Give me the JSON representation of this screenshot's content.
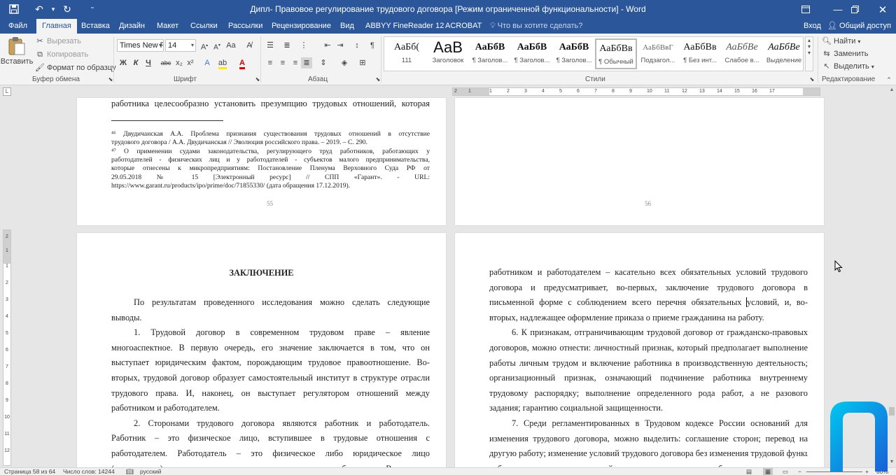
{
  "titlebar": {
    "title": "Дипл- Правовое регулирование трудового договора [Режим ограниченной функциональности] - Word",
    "save_icon": "save-icon",
    "undo_icon": "undo-icon",
    "redo_icon": "redo-icon"
  },
  "tabs": [
    {
      "label": "Файл"
    },
    {
      "label": "Главная",
      "active": true
    },
    {
      "label": "Вставка"
    },
    {
      "label": "Дизайн"
    },
    {
      "label": "Макет"
    },
    {
      "label": "Ссылки"
    },
    {
      "label": "Рассылки"
    },
    {
      "label": "Рецензирование"
    },
    {
      "label": "Вид"
    },
    {
      "label": "ABBYY FineReader 12"
    },
    {
      "label": "ACROBAT"
    }
  ],
  "tell_me": "Что вы хотите сделать?",
  "signin": "Вход",
  "share": "Общий доступ",
  "ribbon": {
    "clipboard": {
      "paste": "Вставить",
      "cut": "Вырезать",
      "copy": "Копировать",
      "format_painter": "Формат по образцу",
      "label": "Буфер обмена"
    },
    "font": {
      "name": "Times New R",
      "size": "14",
      "bold": "Ж",
      "italic": "К",
      "underline": "Ч",
      "strike": "abc",
      "subscript": "x₂",
      "superscript": "x²",
      "case": "Аа",
      "label": "Шрифт"
    },
    "paragraph": {
      "label": "Абзац"
    },
    "styles": {
      "label": "Стили",
      "items": [
        {
          "preview": "АаБб(",
          "name": "111"
        },
        {
          "preview": "АаВ",
          "name": "Заголовок"
        },
        {
          "preview": "АаБбВ",
          "name": "¶ Заголов..."
        },
        {
          "preview": "АаБбВ",
          "name": "¶ Заголов..."
        },
        {
          "preview": "АаБбВ",
          "name": "¶ Заголов..."
        },
        {
          "preview": "АаБбВв",
          "name": "¶ Обычный"
        },
        {
          "preview": "АаБбВвГ",
          "name": "Подзагол..."
        },
        {
          "preview": "АаБбВв",
          "name": "¶ Без инт..."
        },
        {
          "preview": "АаБбВе",
          "name": "Слабое в..."
        },
        {
          "preview": "АаБбВе",
          "name": "Выделение"
        }
      ]
    },
    "editing": {
      "find": "Найти",
      "replace": "Заменить",
      "select": "Выделить",
      "label": "Редактирование"
    }
  },
  "ruler": {
    "ticks": [
      "2",
      "1",
      "1",
      "2",
      "3",
      "4",
      "5",
      "6",
      "7",
      "8",
      "9",
      "10",
      "11",
      "12",
      "13",
      "14",
      "15",
      "16",
      "17"
    ]
  },
  "vruler": {
    "ticks": [
      "2",
      "1",
      "1",
      "2",
      "3",
      "4",
      "5",
      "6",
      "7",
      "8",
      "9",
      "10",
      "11",
      "12"
    ]
  },
  "page55": {
    "top_line": "работника целесообразно установить презумпцию трудовых отношений, которая",
    "footnotes": [
      "⁴⁶ Двудичанская А.А. Проблема признания существования трудовых отношений в отсутствие",
      "трудового договора / А.А. Двудичанская // Эволюция российского права. – 2019. – С. 290.",
      "⁴⁷ О применении судами законодательства, регулирующего труд работников, работающих у",
      "работодателей - физических лиц и у работодателей - субъектов малого предпринимательства,",
      "которые отнесены к микропредприятиям: Постановление Пленума Верховного Суда РФ от",
      "29.05.2018 № 15 [Электронный ресурс] // СПП «Гарант». - URL:",
      "https://www.garant.ru/products/ipo/prime/doc/71855330/ (дата обращения 17.12.2019)."
    ],
    "page_number": "55"
  },
  "page56": {
    "page_number": "56"
  },
  "page57": {
    "heading": "ЗАКЛЮЧЕНИЕ",
    "lines": [
      {
        "t": "По результатам проведенного исследования можно сделать следующие",
        "indent": true,
        "j": true
      },
      {
        "t": "выводы.",
        "j": false
      },
      {
        "t": "1. Трудовой договор в современном трудовом праве – явление",
        "indent": true,
        "j": true
      },
      {
        "t": "многоаспектное. В первую очередь, его значение заключается в том, что он",
        "j": true
      },
      {
        "t": "выступает юридическим фактом, порождающим трудовое правоотношение. Во-",
        "j": true
      },
      {
        "t": "вторых, трудовой договор образует самостоятельный институт в структуре отрасли",
        "j": true
      },
      {
        "t": "трудового права. И, наконец, он выступает регулятором отношений между",
        "j": true
      },
      {
        "t": "работником и работодателем.",
        "j": false
      },
      {
        "t": "2. Сторонами трудового договора являются работник и работодатель.",
        "indent": true,
        "j": true
      },
      {
        "t": "Работник – это физическое лицо, вступившее в трудовые отношения с",
        "j": true
      },
      {
        "t": "работодателем. Работодатель – это физическое либо юридическое лицо",
        "j": true
      },
      {
        "t": "(организация), вступившее в трудовые отношения с работником. В случаях,",
        "j": true
      }
    ]
  },
  "page58": {
    "lines": [
      {
        "t": "работником и работодателем – касательно всех обязательных условий трудового",
        "j": true
      },
      {
        "t": "договора и предусматривает, во-первых, заключение трудового договора в",
        "j": true
      },
      {
        "t": "письменной форме с соблюдением всего перечня обязательных условий, и, во-",
        "j": true
      },
      {
        "t": "вторых, надлежащее оформление приказа о приеме гражданина на работу.",
        "j": false
      },
      {
        "t": "6. К признакам, отграничивающим трудовой договор от гражданско-правовых",
        "indent": true,
        "j": true
      },
      {
        "t": "договоров, можно отнести: личностный признак, который предполагает выполнение",
        "j": true
      },
      {
        "t": "работы личным трудом и включение работника в производственную деятельность;",
        "j": true
      },
      {
        "t": "организационный признак, означающий подчинение работника внутреннему",
        "j": true
      },
      {
        "t": "трудовому распорядку; выполнение определенного рода работ, а не разового",
        "j": true
      },
      {
        "t": "задания; гарантию социальной защищенности.",
        "j": false
      },
      {
        "t": "7. Среди регламентированных в Трудовом кодексе России оснований для",
        "indent": true,
        "j": true
      },
      {
        "t": "изменения трудового договора, можно выделить: соглашение сторон; перевод на",
        "j": true
      },
      {
        "t": "другую работу; изменение условий трудового договора без изменения трудовой функции",
        "j": true
      },
      {
        "t": "работника; изменение условий договора при смене собственника имущества",
        "j": true
      }
    ]
  },
  "statusbar": {
    "page": "Страница 58 из 64",
    "words": "Число слов: 14244",
    "lang": "русский",
    "zoom": "80%"
  },
  "colors": {
    "word_blue": "#2b579a",
    "logo_blue": "#1e88e5",
    "logo_cyan": "#00bcd4"
  }
}
